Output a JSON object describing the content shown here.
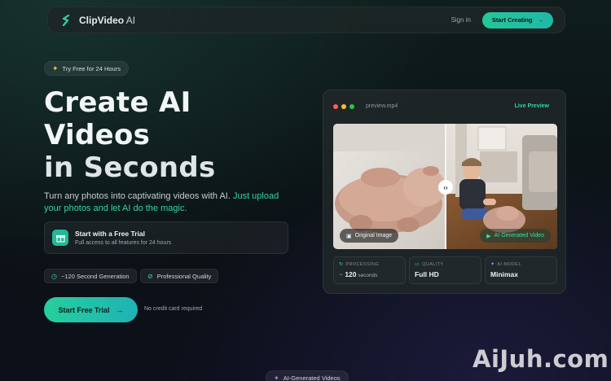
{
  "nav": {
    "logo_name": "ClipVideo",
    "logo_suffix": " AI",
    "signin_label": "Sign in",
    "cta_label": "Start Creating",
    "cta_arrow": "→"
  },
  "hero": {
    "badge_label": "Try Free for 24 Hours",
    "title_line1": "Create AI",
    "title_line2": "Videos",
    "title_line3": "in Seconds",
    "subtitle_plain": "Turn any photos into captivating videos with AI. ",
    "subtitle_highlight": "Just upload your photos and let AI do the magic.",
    "trial_card_title": "Start with a Free Trial",
    "trial_card_subtitle": "Full access to all features for 24 hours",
    "features": [
      {
        "label": "~120 Second Generation",
        "icon": "clock-icon"
      },
      {
        "label": "Professional Quality",
        "icon": "check-circle-icon"
      }
    ],
    "cta_label": "Start Free Trial",
    "cta_arrow": "→",
    "no_card_note": "No credit card required"
  },
  "preview": {
    "filename": "preview.mp4",
    "live_label": "Live Preview",
    "original_tag": "Original Image",
    "generated_tag": "AI Generated Video",
    "stats": [
      {
        "label": "PROCESSING",
        "prefix": "~ ",
        "value": "120",
        "unit": " seconds",
        "icon": "refresh-icon"
      },
      {
        "label": "QUALITY",
        "prefix": "",
        "value": "Full HD",
        "unit": "",
        "icon": "monitor-icon"
      },
      {
        "label": "AI MODEL",
        "prefix": "",
        "value": "Minimax",
        "unit": "",
        "icon": "sparkle-icon"
      }
    ]
  },
  "bottom_badge": "AI-Generated Videos",
  "watermark": "AiJuh.com",
  "colors": {
    "accent": "#2fd6a6",
    "button_gradient_start": "#26cf9c",
    "button_gradient_end": "#1fb2b4",
    "window_dot_red": "#ff5f57",
    "window_dot_yellow": "#febc2e",
    "window_dot_green": "#28c840"
  }
}
